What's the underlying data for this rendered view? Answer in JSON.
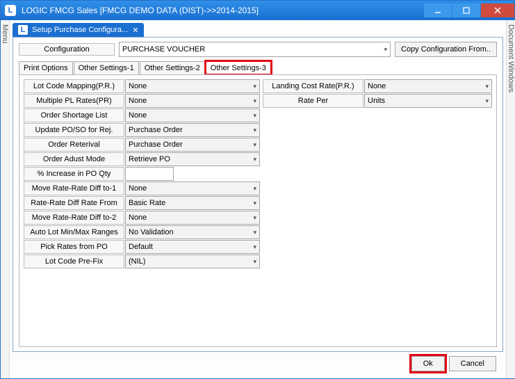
{
  "window": {
    "title": "LOGIC FMCG Sales  [FMCG DEMO DATA (DIST)->>2014-2015]",
    "icon_text": "L"
  },
  "side_left": "Menu",
  "side_right": "Document Windows",
  "doc_tab": {
    "icon_text": "L",
    "label": "Setup Purchase Configura..."
  },
  "config": {
    "label": "Configuration",
    "value": "PURCHASE VOUCHER",
    "copy_btn": "Copy Configuration From.."
  },
  "tabs": [
    "Print Options",
    "Other Settings-1",
    "Other Settings-2",
    "Other Settings-3"
  ],
  "left_rows": [
    {
      "label": "Lot Code Mapping(P.R.)",
      "value": "None",
      "type": "select"
    },
    {
      "label": "Multiple PL Rates(PR)",
      "value": "None",
      "type": "select"
    },
    {
      "label": "Order Shortage List",
      "value": "None",
      "type": "select"
    },
    {
      "label": "Update PO/SO for Rej.",
      "value": "Purchase Order",
      "type": "select"
    },
    {
      "label": "Order Reterival",
      "value": "Purchase Order",
      "type": "select"
    },
    {
      "label": "Order Adust Mode",
      "value": "Retrieve PO",
      "type": "select"
    },
    {
      "label": "% Increase in PO Qty",
      "value": "",
      "type": "input"
    },
    {
      "label": "Move Rate-Rate Diff to-1",
      "value": "None",
      "type": "select"
    },
    {
      "label": "Rate-Rate Diff Rate From",
      "value": "Basic Rate",
      "type": "select"
    },
    {
      "label": "Move Rate-Rate Diff to-2",
      "value": "None",
      "type": "select"
    },
    {
      "label": "Auto Lot Min/Max Ranges",
      "value": "No Validation",
      "type": "select"
    },
    {
      "label": "Pick Rates from PO",
      "value": "Default",
      "type": "select"
    },
    {
      "label": "Lot Code Pre-Fix",
      "value": "(NIL)",
      "type": "select"
    }
  ],
  "right_rows": [
    {
      "label": "Landing Cost Rate(P.R.)",
      "value": "None",
      "type": "select"
    },
    {
      "label": "Rate Per",
      "value": "Units",
      "type": "select"
    }
  ],
  "footer": {
    "ok": "Ok",
    "cancel": "Cancel"
  }
}
